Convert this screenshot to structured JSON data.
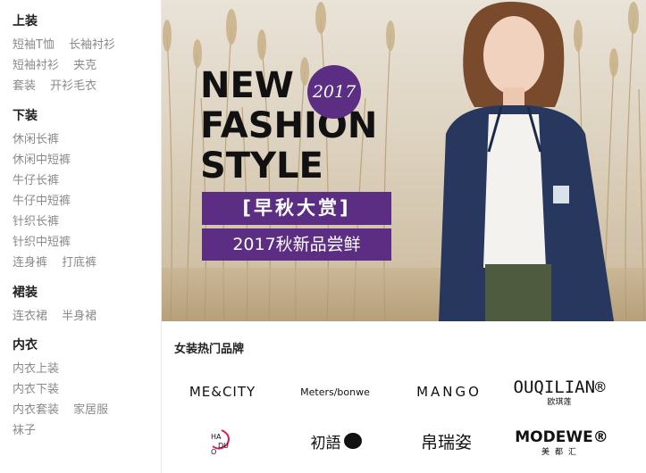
{
  "sidebar": {
    "categories": [
      {
        "title": "上装",
        "links": [
          "短袖T恤",
          "长袖衬衫",
          "短袖衬衫",
          "夹克",
          "套装",
          "开衫毛衣"
        ]
      },
      {
        "title": "下装",
        "links": [
          "休闲长裤",
          "休闲中短裤",
          "牛仔长裤",
          "牛仔中短裤",
          "针织长裤",
          "针织中短裤",
          "连身裤",
          "打底裤"
        ]
      },
      {
        "title": "裙装",
        "links": [
          "连衣裙",
          "半身裙"
        ]
      },
      {
        "title": "内衣",
        "links": [
          "内衣上装",
          "内衣下装",
          "内衣套装",
          "家居服",
          "袜子"
        ]
      }
    ]
  },
  "banner": {
    "headline": [
      "NEW",
      "FASHION",
      "STYLE"
    ],
    "year": "2017",
    "tag_main": "[早秋大赏]",
    "tag_sub": "2017秋新品尝鲜",
    "accent_color": "#5b2d83"
  },
  "brands": {
    "title": "女装热门品牌",
    "items": {
      "mecity": "ME&CITY",
      "meters": "Meters/bonwe",
      "mango": "MANGO",
      "ouqilian": {
        "name": "OUQILIAN®",
        "cn": "欧琪莲"
      },
      "haduo": "HADUO",
      "chuyu": "初語",
      "quanruizi": "帛瑞姿",
      "modewe": {
        "name": "MODEWE®",
        "cn": "美都汇"
      }
    }
  }
}
